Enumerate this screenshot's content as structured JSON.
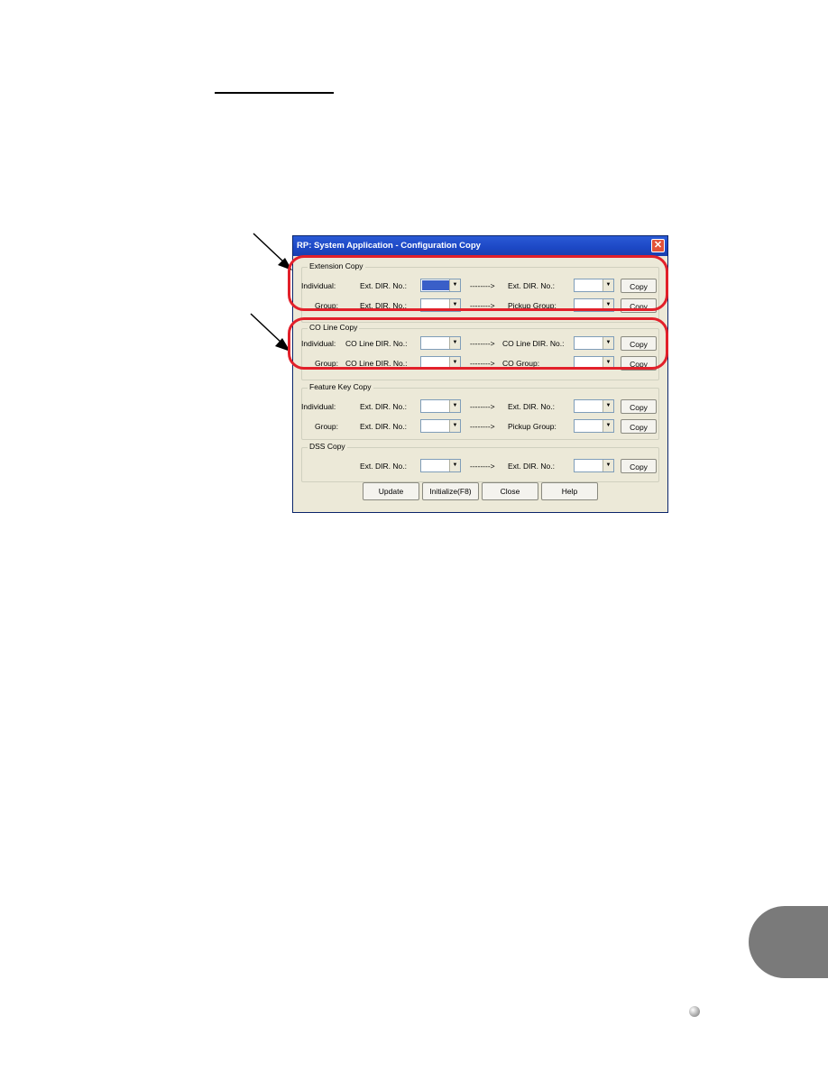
{
  "dialog": {
    "title": "RP: System Application - Configuration Copy",
    "close_icon": "close-icon",
    "groups": [
      {
        "title": "Extension Copy",
        "rows": [
          {
            "label": "Individual:",
            "source_label": "Ext. DIR. No.:",
            "source_value": "",
            "arrow": "-------->",
            "target_label": "Ext. DIR. No.:",
            "target_value": "",
            "button": "Copy"
          },
          {
            "label": "Group:",
            "source_label": "Ext. DIR. No.:",
            "source_value": "",
            "arrow": "-------->",
            "target_label": "Pickup Group:",
            "target_value": "",
            "button": "Copy"
          }
        ]
      },
      {
        "title": "CO Line Copy",
        "rows": [
          {
            "label": "Individual:",
            "source_label": "CO Line DIR. No.:",
            "source_value": "",
            "arrow": "-------->",
            "target_label": "CO Line DIR. No.:",
            "target_value": "",
            "button": "Copy"
          },
          {
            "label": "Group:",
            "source_label": "CO Line DIR. No.:",
            "source_value": "",
            "arrow": "-------->",
            "target_label": "CO Group:",
            "target_value": "",
            "button": "Copy"
          }
        ]
      },
      {
        "title": "Feature Key Copy",
        "rows": [
          {
            "label": "Individual:",
            "source_label": "Ext. DIR. No.:",
            "source_value": "",
            "arrow": "-------->",
            "target_label": "Ext. DIR. No.:",
            "target_value": "",
            "button": "Copy"
          },
          {
            "label": "Group:",
            "source_label": "Ext. DIR. No.:",
            "source_value": "",
            "arrow": "-------->",
            "target_label": "Pickup Group:",
            "target_value": "",
            "button": "Copy"
          }
        ]
      },
      {
        "title": "DSS Copy",
        "rows": [
          {
            "label": "",
            "source_label": "Ext. DIR. No.:",
            "source_value": "",
            "arrow": "-------->",
            "target_label": "Ext. DIR. No.:",
            "target_value": "",
            "button": "Copy"
          }
        ]
      }
    ],
    "buttons": {
      "update": "Update",
      "initialize": "Initialize(F8)",
      "close": "Close",
      "help": "Help"
    }
  },
  "annotations": {
    "highlight_color": "#e2202a",
    "callouts": [
      "extension-copy",
      "co-line-copy"
    ]
  }
}
